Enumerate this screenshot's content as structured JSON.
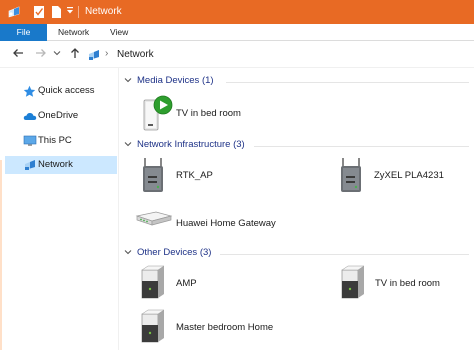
{
  "window": {
    "title": "Network"
  },
  "ribbon": {
    "tabs": [
      "File",
      "Network",
      "View"
    ]
  },
  "address": {
    "path": "Network"
  },
  "nav": {
    "items": [
      {
        "label": "Quick access",
        "icon": "star-icon"
      },
      {
        "label": "OneDrive",
        "icon": "cloud-icon"
      },
      {
        "label": "This PC",
        "icon": "computer-icon"
      },
      {
        "label": "Network",
        "icon": "network-icon",
        "selected": true
      }
    ]
  },
  "groups": [
    {
      "title": "Media Devices (1)",
      "items": [
        {
          "label": "TV in bed room",
          "icon": "media-device-icon"
        }
      ]
    },
    {
      "title": "Network Infrastructure (3)",
      "items": [
        {
          "label": "RTK_AP",
          "icon": "access-point-icon"
        },
        {
          "label": "ZyXEL PLA4231",
          "icon": "access-point-icon"
        },
        {
          "label": "Huawei Home Gateway",
          "icon": "gateway-icon"
        }
      ]
    },
    {
      "title": "Other Devices (3)",
      "items": [
        {
          "label": "AMP",
          "icon": "device-icon"
        },
        {
          "label": "TV in bed room",
          "icon": "device-icon"
        },
        {
          "label": "Master bedroom Home",
          "icon": "device-icon"
        }
      ]
    }
  ],
  "colors": {
    "titlebar": "#e86a24",
    "file_tab": "#1979ca",
    "selection": "#cce8ff",
    "group_header": "#1e3287"
  }
}
